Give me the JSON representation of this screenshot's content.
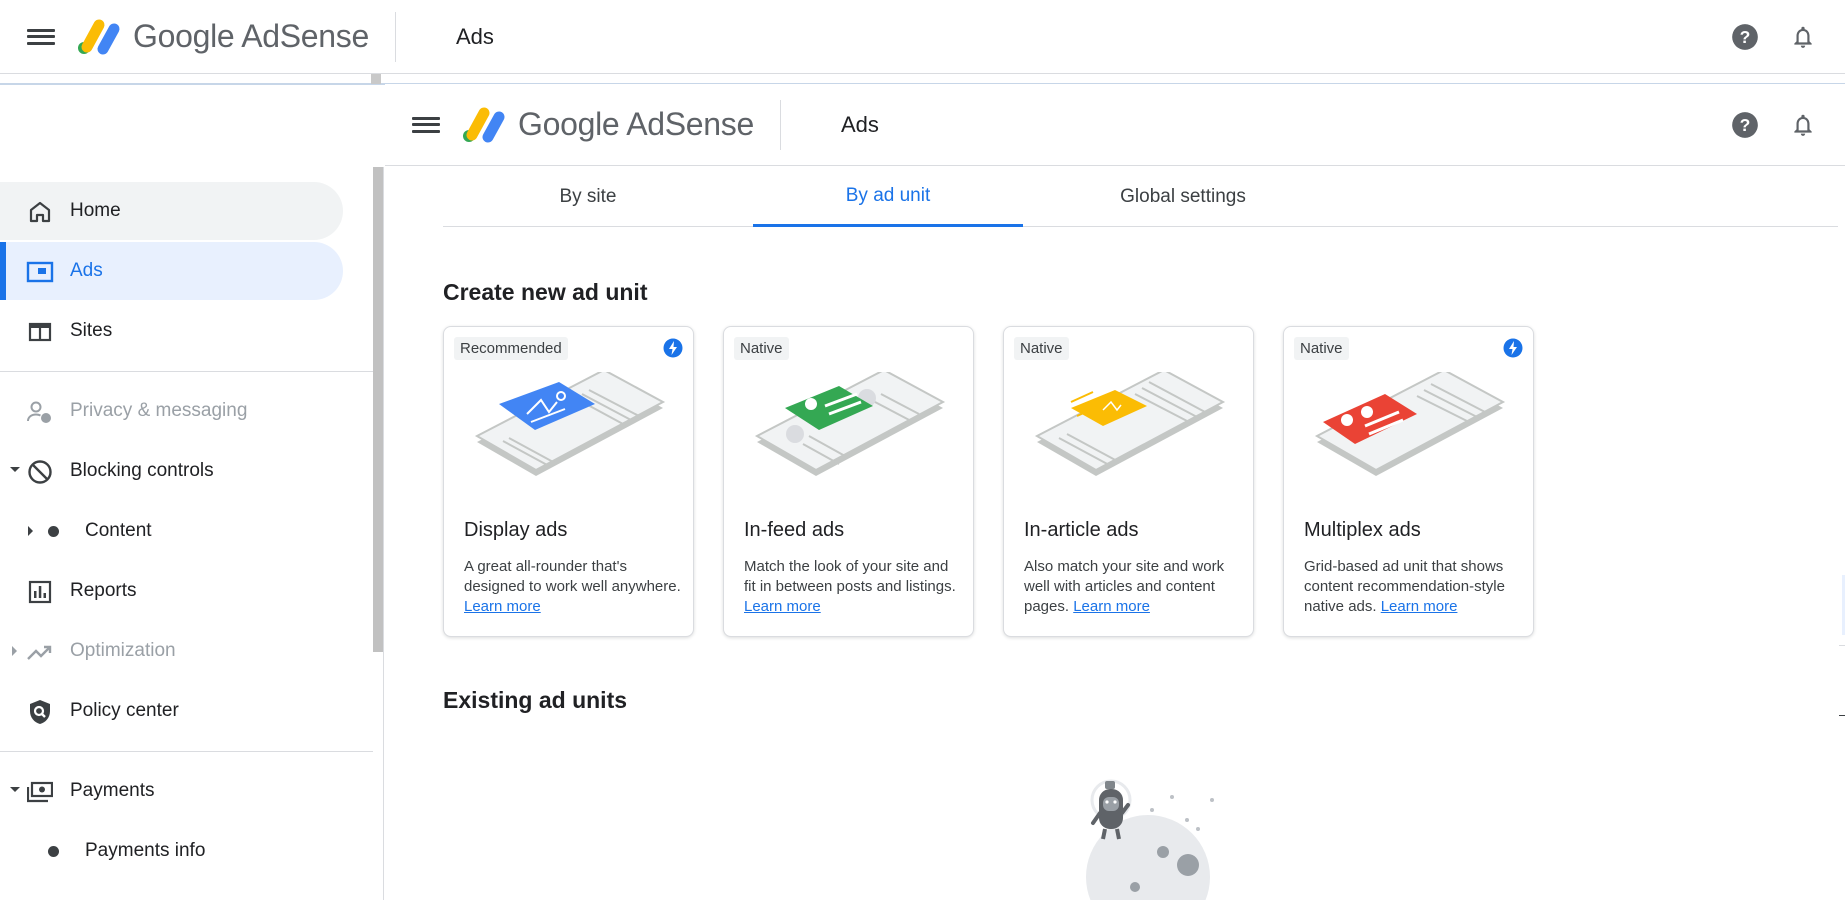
{
  "header": {
    "logo_text": "Google AdSense",
    "page_title": "Ads"
  },
  "sidebar": {
    "items": [
      {
        "label": "Home",
        "icon": "home-icon",
        "state": "hover"
      },
      {
        "label": "Ads",
        "icon": "ads-icon",
        "state": "active"
      },
      {
        "label": "Sites",
        "icon": "sites-icon",
        "state": "normal"
      },
      {
        "label": "Privacy & messaging",
        "icon": "privacy-icon",
        "state": "disabled"
      },
      {
        "label": "Blocking controls",
        "icon": "block-icon",
        "state": "expanded"
      },
      {
        "label": "Content",
        "icon": "dot",
        "state": "sub"
      },
      {
        "label": "Reports",
        "icon": "reports-icon",
        "state": "normal"
      },
      {
        "label": "Optimization",
        "icon": "trending-icon",
        "state": "disabled"
      },
      {
        "label": "Policy center",
        "icon": "policy-icon",
        "state": "normal"
      },
      {
        "label": "Payments",
        "icon": "payments-icon",
        "state": "expanded"
      },
      {
        "label": "Payments info",
        "icon": "dot",
        "state": "sub"
      }
    ]
  },
  "tabs": [
    {
      "label": "By site",
      "active": false
    },
    {
      "label": "By ad unit",
      "active": true
    },
    {
      "label": "Global settings",
      "active": false
    }
  ],
  "create_section": {
    "title": "Create new ad unit",
    "cards": [
      {
        "badge": "Recommended",
        "auto_icon": true,
        "title": "Display ads",
        "desc": "A great all-rounder that's designed to work well anywhere.",
        "link": "Learn more",
        "accent": "#4285f4"
      },
      {
        "badge": "Native",
        "auto_icon": false,
        "title": "In-feed ads",
        "desc": "Match the look of your site and fit in between posts and listings.",
        "link": "Learn more",
        "accent": "#34a853"
      },
      {
        "badge": "Native",
        "auto_icon": false,
        "title": "In-article ads",
        "desc": "Also match your site and work well with articles and content pages.",
        "link": "Learn more",
        "accent": "#fbbc04"
      },
      {
        "badge": "Native",
        "auto_icon": true,
        "title": "Multiplex ads",
        "desc": "Grid-based ad unit that shows content recommendation-style native ads.",
        "link": "Learn more",
        "accent": "#ea4335"
      }
    ]
  },
  "existing_section": {
    "title": "Existing ad units"
  },
  "colors": {
    "accent": "#1a73e8",
    "active_bg": "#e8f0fe"
  }
}
